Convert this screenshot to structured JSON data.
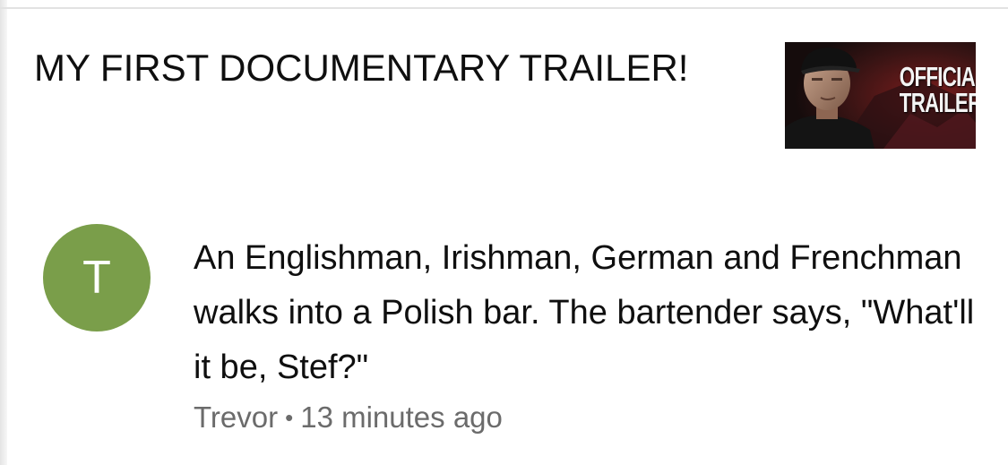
{
  "video": {
    "title": "MY FIRST DOCUMENTARY TRAILER!",
    "thumbnail": {
      "icon": "video-thumbnail",
      "text_line1": "OFFICIAL",
      "text_line2": "TRAILER"
    }
  },
  "comment": {
    "avatar_letter": "T",
    "avatar_color": "#7a9e4a",
    "text": "An Englishman, Irishman, German and Frenchman walks into a Polish bar. The bartender says, \"What'll it be, Stef?\"",
    "author": "Trevor",
    "separator": "•",
    "time": "13 minutes ago"
  }
}
